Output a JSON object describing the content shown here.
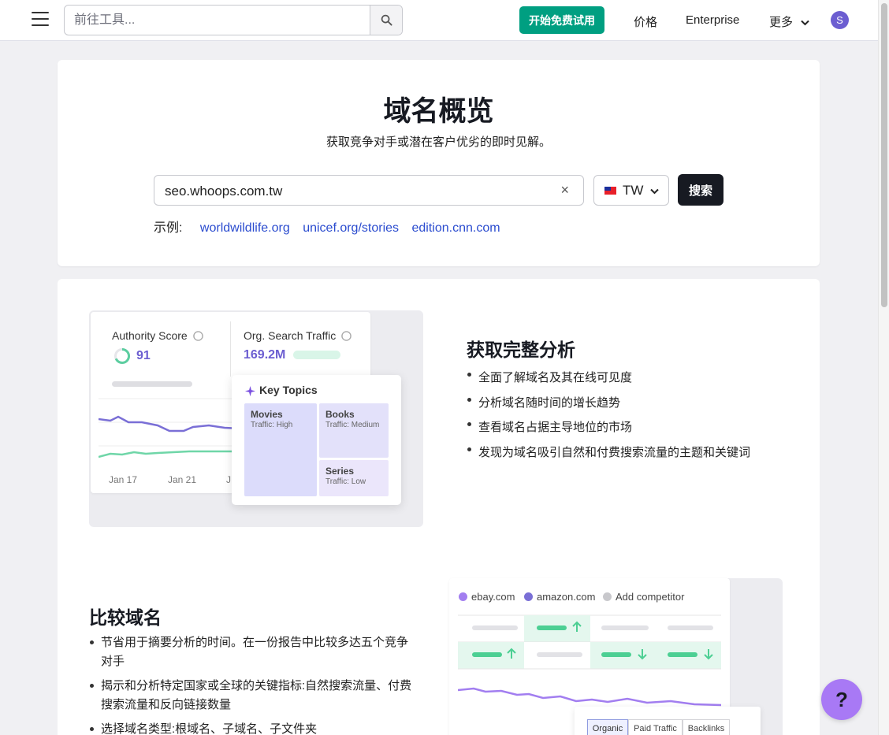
{
  "header": {
    "search_placeholder": "前往工具...",
    "trial_label": "开始免费试用",
    "nav": {
      "pricing": "价格",
      "enterprise": "Enterprise",
      "more": "更多"
    },
    "avatar_letter": "S"
  },
  "hero": {
    "title": "域名概览",
    "subtitle": "获取竞争对手或潜在客户优劣的即时见解。",
    "domain_value": "seo.whoops.com.tw",
    "clear_symbol": "×",
    "country_code": "TW",
    "search_label": "搜索",
    "examples_label": "示例:",
    "examples": [
      "worldwildlife.org",
      "unicef.org/stories",
      "edition.cnn.com"
    ]
  },
  "feature1": {
    "title": "获取完整分析",
    "bullets": [
      "全面了解域名及其在线可见度",
      "分析域名随时间的增长趋势",
      "查看域名占据主导地位的市场",
      "发现为域名吸引自然和付费搜索流量的主题和关键词"
    ],
    "mock": {
      "authority_label": "Authority Score",
      "authority_value": "91",
      "traffic_label": "Org. Search Traffic",
      "traffic_value": "169.2M",
      "key_topics_title": "Key Topics",
      "topics": [
        {
          "name": "Movies",
          "traffic": "Traffic: High"
        },
        {
          "name": "Books",
          "traffic": "Traffic: Medium"
        },
        {
          "name": "Series",
          "traffic": "Traffic: Low"
        }
      ],
      "axis": [
        "Jan 17",
        "Jan 21",
        "J"
      ]
    }
  },
  "feature2": {
    "title": "比较域名",
    "bullets": [
      "节省用于摘要分析的时间。在一份报告中比较多达五个竞争对手",
      "揭示和分析特定国家或全球的关键指标:自然搜索流量、付费搜索流量和反向链接数量",
      "选择域名类型:根域名、子域名、子文件夹"
    ],
    "mock": {
      "legend": [
        {
          "name": "ebay.com",
          "color": "#a27ef0"
        },
        {
          "name": "amazon.com",
          "color": "#7a6fd6"
        },
        {
          "name": "Add competitor",
          "color": "#c8c8cc"
        }
      ],
      "tabs": [
        "Organic",
        "Paid Traffic",
        "Backlinks"
      ]
    }
  },
  "help_label": "?",
  "colors": {
    "brand_green": "#009f81",
    "link": "#2b4ccf",
    "accent_purple": "#6c5ed1"
  }
}
